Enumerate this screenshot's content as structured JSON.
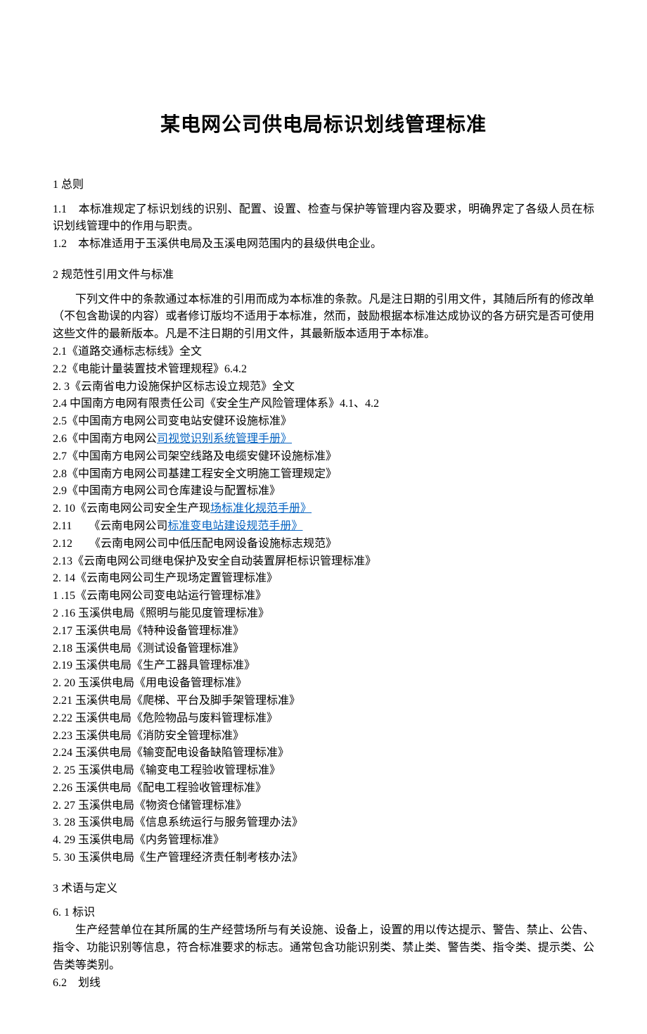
{
  "title": "某电网公司供电局标识划线管理标准",
  "section1": {
    "heading": "1 总则",
    "p1": "1.1　本标准规定了标识划线的识别、配置、设置、检查与保护等管理内容及要求，明确界定了各级人员在标识划线管理中的作用与职责。",
    "p2": "1.2　本标准适用于玉溪供电局及玉溪电网范围内的县级供电企业。"
  },
  "section2": {
    "heading": "2 规范性引用文件与标准",
    "intro": "下列文件中的条款通过本标准的引用而成为本标准的条款。凡是注日期的引用文件，其随后所有的修改单（不包含勘误的内容）或者修订版均不适用于本标准，然而，鼓励根据本标准达成协议的各方研究是否可使用这些文件的最新版本。凡是不注日期的引用文件，其最新版本适用于本标准。",
    "refs": [
      {
        "text": "2.1《道路交通标志标线》全文"
      },
      {
        "text": "2.2《电能计量装置技术管理规程》6.4.2"
      },
      {
        "text": "2. 3《云南省电力设施保护区标志设立规范》全文"
      },
      {
        "text": "2.4 中国南方电网有限责任公司《安全生产风险管理体系》4.1、4.2"
      },
      {
        "text": "2.5《中国南方电网公司变电站安健环设施标准》"
      },
      {
        "pre": "2.6《中国南方电网公",
        "link": "司视觉识别系统管理手册》",
        "post": ""
      },
      {
        "text": "2.7《中国南方电网公司架空线路及电缆安健环设施标准》"
      },
      {
        "text": "2.8《中国南方电网公司基建工程安全文明施工管理规定》"
      },
      {
        "text": "2.9《中国南方电网公司仓库建设与配置标准》"
      },
      {
        "pre": "2. 10《云南电网公司安全生产现",
        "link": "场标准化规范手册》",
        "post": ""
      },
      {
        "pre": "2.11　　《云南电网公司",
        "link": "标准变电站建设规范手册》",
        "post": ""
      },
      {
        "text": "2.12　　《云南电网公司中低压配电网设备设施标志规范》"
      },
      {
        "text": "2.13《云南电网公司继电保护及安全自动装置屏柜标识管理标准》"
      },
      {
        "text": "2. 14《云南电网公司生产现场定置管理标准》"
      },
      {
        "text": "1 .15《云南电网公司变电站运行管理标准》"
      },
      {
        "text": "2 .16 玉溪供电局《照明与能见度管理标准》"
      },
      {
        "text": "2.17 玉溪供电局《特种设备管理标准》"
      },
      {
        "text": "2.18 玉溪供电局《测试设备管理标准》"
      },
      {
        "text": "2.19 玉溪供电局《生产工器具管理标准》"
      },
      {
        "text": "2. 20 玉溪供电局《用电设备管理标准》"
      },
      {
        "text": "2.21 玉溪供电局《爬梯、平台及脚手架管理标准》"
      },
      {
        "text": "2.22 玉溪供电局《危险物品与废料管理标准》"
      },
      {
        "text": "2.23 玉溪供电局《消防安全管理标准》"
      },
      {
        "text": "2.24 玉溪供电局《输变配电设备缺陷管理标准》"
      },
      {
        "text": "2. 25 玉溪供电局《输变电工程验收管理标准》"
      },
      {
        "text": "2.26 玉溪供电局《配电工程验收管理标准》"
      },
      {
        "text": "2. 27 玉溪供电局《物资仓储管理标准》"
      },
      {
        "text": "3. 28 玉溪供电局《信息系统运行与服务管理办法》"
      },
      {
        "text": "4. 29 玉溪供电局《内务管理标准》"
      },
      {
        "text": "5. 30 玉溪供电局《生产管理经济责任制考核办法》"
      }
    ]
  },
  "section3": {
    "heading": "3 术语与定义",
    "sub1_num": "6. 1 标识",
    "sub1_body": "生产经营单位在其所属的生产经营场所与有关设施、设备上，设置的用以传达提示、警告、禁止、公告、指令、功能识别等信息，符合标准要求的标志。通常包含功能识别类、禁止类、警告类、指令类、提示类、公告类等类别。",
    "sub2_num": "6.2　划线"
  }
}
